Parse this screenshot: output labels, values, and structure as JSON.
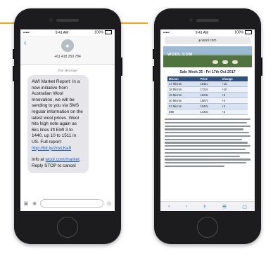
{
  "colors": {
    "accent_line": "#f3a917",
    "phone_body": "#1c1c1e",
    "bubble": "#e5e5ea",
    "link": "#1a5fd0",
    "table_header": "#2f4f7f"
  },
  "messages_phone": {
    "status": {
      "signal": "•••••",
      "time": "9:41 AM",
      "battery": "100%"
    },
    "back_icon": "chevron-left-icon",
    "contact": {
      "avatar_icon": "person-icon",
      "number": "+61 418 250 784"
    },
    "timestamp": "Text Message",
    "message": {
      "body": "AWI Market Report: In a new initiative from Australian Wool Innovation, we will be sending to you via SMS regular information on the latest wool prices. Wool hits high note again as 6ks lines lift EMI 3 to 1440, up 10 to 1511 in US. Full report:",
      "link": "http://bit.ly/2nxLKa9",
      "footer_prefix": "Info at",
      "footer_link": "wool.com/market",
      "footer_suffix": ". Reply STOP to cancel"
    },
    "composer_icons": [
      "camera-icon",
      "apps-icon",
      "mic-icon",
      "emoji-icon"
    ]
  },
  "browser_phone": {
    "status": {
      "signal": "•••••",
      "time": "9:41 AM",
      "battery": "100%"
    },
    "url": "wool.com",
    "header_logo": "WOOL.COM",
    "page_title": "Sale Week 35 - Fri 17th Oct 2017",
    "table": {
      "headers": [
        "Micron",
        "Price",
        "Change"
      ],
      "rows": [
        [
          "17 Micron",
          "1811c",
          "+15"
        ],
        [
          "18 Micron",
          "1722c",
          "+10"
        ],
        [
          "19 Micron",
          "1623c",
          "+8"
        ],
        [
          "20 Micron",
          "1587c",
          "+4"
        ],
        [
          "21 Micron",
          "1542c",
          "+3"
        ],
        [
          "EMI",
          "1440c",
          "+3"
        ]
      ]
    },
    "toolbar_icons": [
      "back-icon",
      "forward-icon",
      "share-icon",
      "bookmarks-icon",
      "tabs-icon"
    ]
  }
}
